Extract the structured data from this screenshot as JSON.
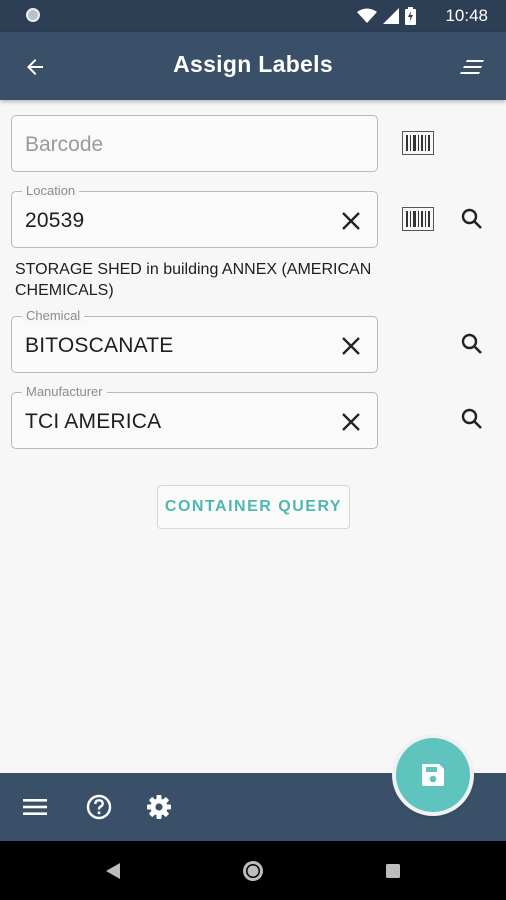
{
  "status_bar": {
    "time": "10:48",
    "icons": [
      "notification-dot-icon",
      "wifi-icon",
      "signal-icon",
      "battery-icon"
    ]
  },
  "app_bar": {
    "title": "Assign Labels",
    "icons": [
      "back-arrow-icon",
      "sort-menu-icon"
    ],
    "background": "#3a5068"
  },
  "form": {
    "barcode": {
      "placeholder": "Barcode",
      "value": ""
    },
    "location": {
      "label": "Location",
      "value": "20539"
    },
    "location_description": "STORAGE SHED in building ANNEX (AMERICAN CHEMICALS)",
    "chemical": {
      "label": "Chemical",
      "value": "BITOSCANATE"
    },
    "manufacturer": {
      "label": "Manufacturer",
      "value": "TCI AMERICA"
    }
  },
  "actions": {
    "container_query_label": "CONTAINER QUERY",
    "accent_color": "#4fb8b0"
  },
  "bottom_bar": {
    "icons": [
      "hamburger-menu-icon",
      "help-icon",
      "settings-icon",
      "save-icon"
    ]
  },
  "nav_bar": {
    "icons": [
      "back-triangle-icon",
      "home-circle-icon",
      "recents-square-icon"
    ]
  }
}
